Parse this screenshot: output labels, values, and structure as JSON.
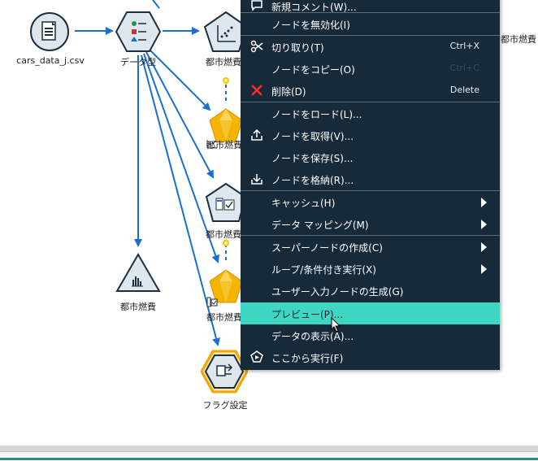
{
  "canvas": {
    "nodes": [
      {
        "id": "source",
        "label": "cars_data_j.csv",
        "icon": "database-file-icon"
      },
      {
        "id": "type",
        "label": "データ型",
        "icon": "type-node-icon"
      },
      {
        "id": "plot1",
        "label": "都市燃費",
        "icon": "scatter-plot-icon"
      },
      {
        "id": "model1",
        "label": "都市燃費",
        "icon": "model-nugget-icon"
      },
      {
        "id": "table1",
        "label": "都市燃費",
        "icon": "table-node-icon"
      },
      {
        "id": "model2",
        "label": "都市燃費",
        "icon": "model-nugget-icon"
      },
      {
        "id": "hist",
        "label": "都市燃費",
        "icon": "histogram-icon"
      },
      {
        "id": "flag",
        "label": "フラグ設定",
        "icon": "flag-node-icon"
      },
      {
        "id": "right_label",
        "label": "都市燃費"
      }
    ]
  },
  "context_menu": {
    "items": [
      {
        "label": "新規コメント(W)...",
        "shortcut": "",
        "icon": "comment-icon"
      },
      {
        "label": "ノードを無効化(I)",
        "shortcut": "",
        "icon": ""
      },
      {
        "label": "切り取り(T)",
        "shortcut": "Ctrl+X",
        "icon": "scissors-icon"
      },
      {
        "label": "ノードをコピー(O)",
        "shortcut": "Ctrl+C",
        "icon": ""
      },
      {
        "label": "削除(D)",
        "shortcut": "Delete",
        "icon": "delete-x-icon"
      },
      {
        "label": "ノードをロード(L)...",
        "shortcut": "",
        "icon": ""
      },
      {
        "label": "ノードを取得(V)...",
        "shortcut": "",
        "icon": "upload-icon"
      },
      {
        "label": "ノードを保存(S)...",
        "shortcut": "",
        "icon": ""
      },
      {
        "label": "ノードを格納(R)...",
        "shortcut": "",
        "icon": "download-icon"
      },
      {
        "label": "キャッシュ(H)",
        "shortcut": "",
        "icon": "",
        "submenu": true
      },
      {
        "label": "データ マッピング(M)",
        "shortcut": "",
        "icon": "",
        "submenu": true
      },
      {
        "label": "スーパーノードの作成(C)",
        "shortcut": "",
        "icon": "",
        "submenu": true
      },
      {
        "label": "ループ/条件付き実行(X)",
        "shortcut": "",
        "icon": "",
        "submenu": true
      },
      {
        "label": "ユーザー入力ノードの生成(G)",
        "shortcut": "",
        "icon": ""
      },
      {
        "label": "プレビュー(P)...",
        "shortcut": "",
        "icon": "",
        "highlighted": true
      },
      {
        "label": "データの表示(A)...",
        "shortcut": "",
        "icon": ""
      },
      {
        "label": "ここから実行(F)",
        "shortcut": "",
        "icon": "run-from-here-icon"
      }
    ]
  },
  "colors": {
    "menu_bg": "#172a3a",
    "highlight": "#3fd6c3",
    "link": "#1a6fd1"
  }
}
